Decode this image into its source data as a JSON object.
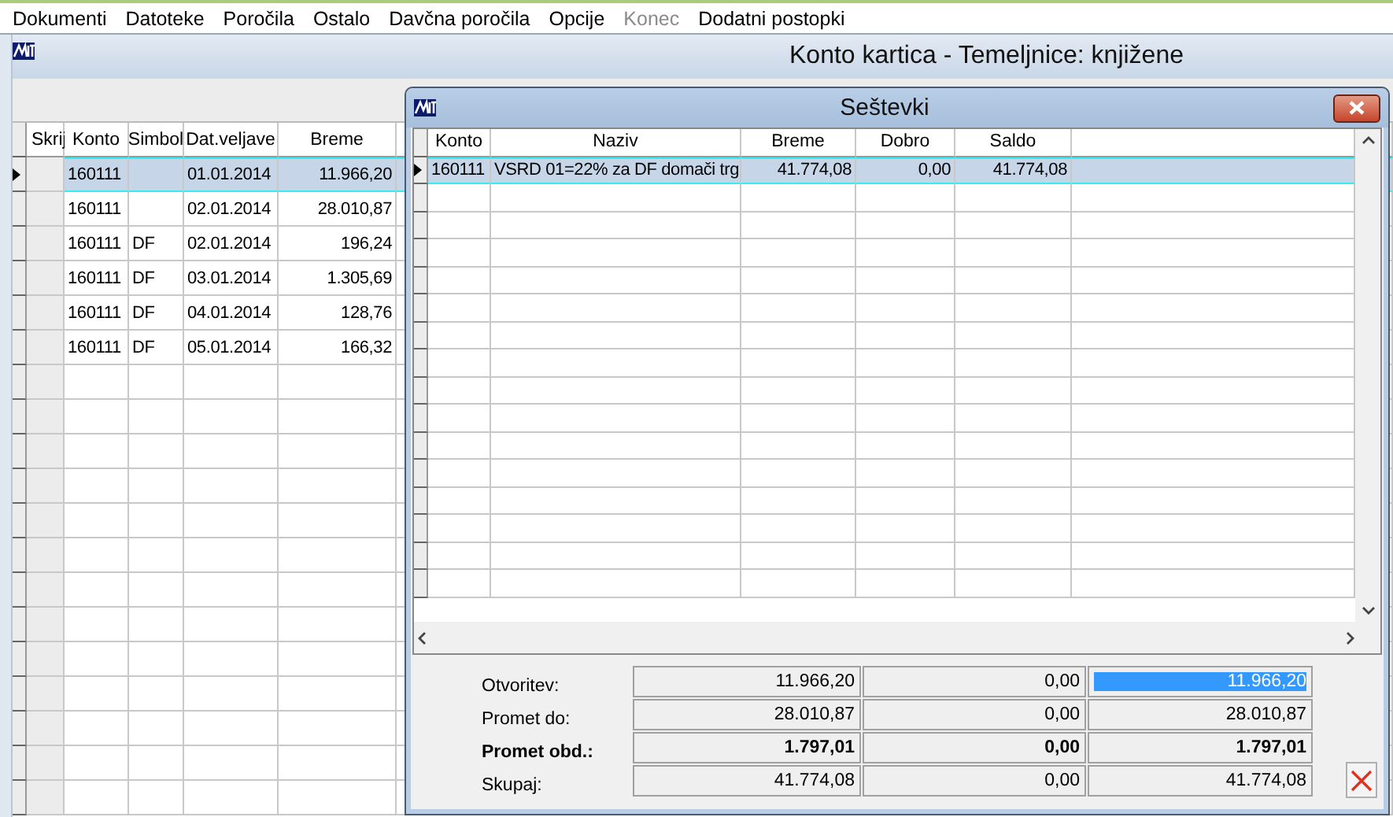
{
  "menu": [
    {
      "label": "Dokumenti",
      "disabled": false
    },
    {
      "label": "Datoteke",
      "disabled": false
    },
    {
      "label": "Poročila",
      "disabled": false
    },
    {
      "label": "Ostalo",
      "disabled": false
    },
    {
      "label": "Davčna poročila",
      "disabled": false
    },
    {
      "label": "Opcije",
      "disabled": false
    },
    {
      "label": "Konec",
      "disabled": true
    },
    {
      "label": "Dodatni postopki",
      "disabled": false
    }
  ],
  "window": {
    "title": "Konto kartica - Temeljnice: knjižene"
  },
  "table": {
    "columns": [
      "Skrij",
      "Konto",
      "Simbol",
      "Dat.veljave",
      "Breme"
    ],
    "rows": [
      {
        "selected": true,
        "cells": [
          "",
          "160111",
          "",
          "01.01.2014",
          "11.966,20"
        ]
      },
      {
        "selected": false,
        "cells": [
          "",
          "160111",
          "",
          "02.01.2014",
          "28.010,87"
        ]
      },
      {
        "selected": false,
        "cells": [
          "",
          "160111",
          "DF",
          "02.01.2014",
          "196,24"
        ]
      },
      {
        "selected": false,
        "cells": [
          "",
          "160111",
          "DF",
          "03.01.2014",
          "1.305,69"
        ]
      },
      {
        "selected": false,
        "cells": [
          "",
          "160111",
          "DF",
          "04.01.2014",
          "128,76"
        ]
      },
      {
        "selected": false,
        "cells": [
          "",
          "160111",
          "DF",
          "05.01.2014",
          "166,32"
        ]
      }
    ]
  },
  "dialog": {
    "title": "Seštevki",
    "table": {
      "columns": [
        "Konto",
        "Naziv",
        "Breme",
        "Dobro",
        "Saldo"
      ],
      "rows": [
        {
          "selected": true,
          "cells": [
            "160111",
            "VSRD 01=22% za DF domači trg",
            "41.774,08",
            "0,00",
            "41.774,08"
          ]
        }
      ]
    },
    "summary": [
      {
        "label": "Otvoritev:",
        "emphasis": false,
        "cells": [
          {
            "value": "11.966,20",
            "selected": false
          },
          {
            "value": "0,00",
            "selected": false
          },
          {
            "value": "11.966,20",
            "selected": true
          }
        ]
      },
      {
        "label": "Promet do:",
        "emphasis": false,
        "cells": [
          {
            "value": "28.010,87",
            "selected": false
          },
          {
            "value": "0,00",
            "selected": false
          },
          {
            "value": "28.010,87",
            "selected": false
          }
        ]
      },
      {
        "label": "Promet obd.:",
        "emphasis": true,
        "cells": [
          {
            "value": "1.797,01",
            "selected": false
          },
          {
            "value": "0,00",
            "selected": false
          },
          {
            "value": "1.797,01",
            "selected": false
          }
        ]
      },
      {
        "label": "Skupaj:",
        "emphasis": false,
        "cells": [
          {
            "value": "41.774,08",
            "selected": false
          },
          {
            "value": "0,00",
            "selected": false
          },
          {
            "value": "41.774,08",
            "selected": false
          }
        ]
      }
    ]
  }
}
